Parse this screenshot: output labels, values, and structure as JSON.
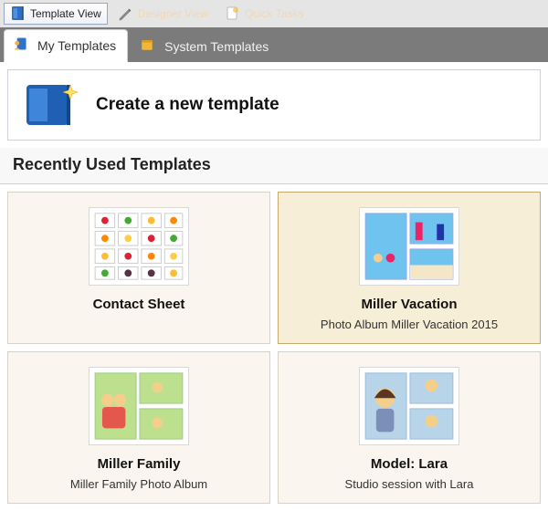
{
  "toolbar": {
    "template_view_label": "Template View",
    "designer_view_label": "Designer View",
    "quick_tasks_label": "Quick Tasks"
  },
  "tabs": {
    "my_templates": "My Templates",
    "system_templates": "System Templates"
  },
  "banner": {
    "title": "Create a new template"
  },
  "section": {
    "recently_used": "Recently Used Templates"
  },
  "templates": [
    {
      "name": "Contact Sheet",
      "desc": ""
    },
    {
      "name": "Miller Vacation",
      "desc": "Photo Album Miller Vacation 2015"
    },
    {
      "name": "Miller Family",
      "desc": "Miller Family Photo Album"
    },
    {
      "name": "Model: Lara",
      "desc": "Studio session with Lara"
    }
  ]
}
